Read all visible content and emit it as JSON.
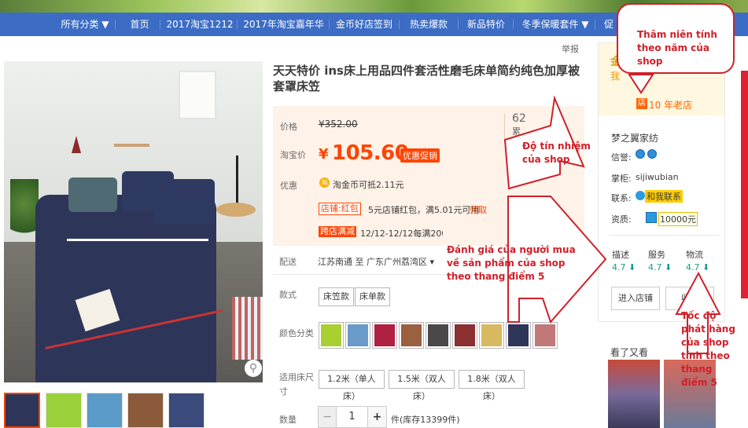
{
  "nav": {
    "items": [
      "所有分类 ▼",
      "首页",
      "2017淘宝1212",
      "2017年淘宝嘉年华",
      "金币好店签到",
      "热卖爆款",
      "新品特价",
      "冬季保暖套件 ▼",
      "促"
    ]
  },
  "product": {
    "report": "举报",
    "title": "天天特价 ins床上用品四件套活性磨毛床单简约纯色加厚被套罩床笠",
    "price_label": "价格",
    "old_price": "¥352.00",
    "taobao_label": "淘宝价",
    "yen": "¥",
    "price": "105.60",
    "promo_label": "优惠促销",
    "sales": "62",
    "sales_unit": "累",
    "offer_label": "优惠",
    "coin_icon": "淘",
    "coin_text": "淘金币可抵2.11元",
    "store_tag": "店铺:红包",
    "redpack_text": "5元店铺红包，满5.01元可用",
    "get_link": "领取",
    "cross_tag": "跨店满减",
    "cross_text": "12/12-12/12每满200元",
    "delivery_label": "配送",
    "route": "江苏南通 至  广东广州荔湾区 ▾",
    "style_label": "款式",
    "styles": [
      "床笠款",
      "床单款"
    ],
    "color_label": "颜色分类",
    "size_label": "适用床尺寸",
    "sizes": [
      "1.2米（单人床）",
      "1.5米（双人床）",
      "1.8米（双人床）"
    ],
    "qty_label": "数量",
    "minus": "−",
    "qty": "1",
    "plus": "+",
    "stock": "件(库存13399件)",
    "zoom_icon": "magnifier-icon"
  },
  "shop": {
    "gold_title": "金",
    "gold_sub": "我",
    "old_icon": "店",
    "years_text": "10 年老店",
    "name": "梦之翼家纺",
    "credit_label": "信誉:",
    "keeper_label": "掌柜:",
    "keeper": "sijiwubian",
    "contact_label": "联系:",
    "contact_text": "和我联系",
    "qual_label": "资质:",
    "deposit": "10000元",
    "ratings": [
      {
        "label": "描述",
        "value": "4.7 ⬇"
      },
      {
        "label": "服务",
        "value": "4.7 ⬇"
      },
      {
        "label": "物流",
        "value": "4.7 ⬇"
      }
    ],
    "enter": "进入店铺",
    "fav": "收藏",
    "see_also": "看了又看"
  },
  "annotations": {
    "seniority": "Thâm niên tính theo năm của shop",
    "credibility": "Độ tín nhiệm của shop",
    "buyer_rating": "Đánh giá của người mua về sản phẩm của shop theo thang điểm 5",
    "shipping_speed": "Tốc độ phát hàng của shop tính theo thang điểm 5"
  },
  "colors": {
    "accent": "#ff4400",
    "nav": "#3c6cc4",
    "annotation": "#d0202a",
    "rating": "#1a9b8e"
  }
}
